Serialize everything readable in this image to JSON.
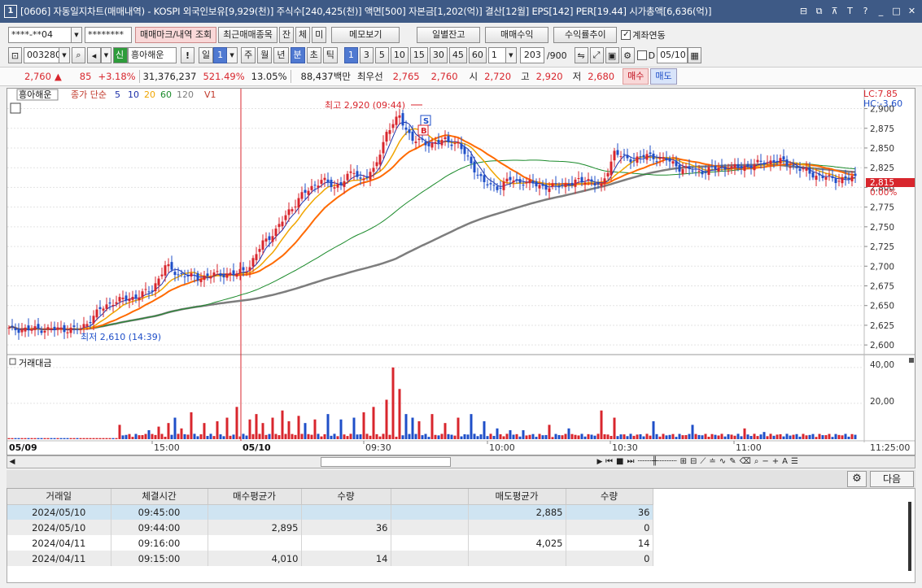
{
  "window": {
    "app_number": "1",
    "title": "[0606] 자동일지차트(매매내역) - KOSPI 외국인보유[9,929(천)] 주식수[240,425(천)] 액면[500] 자본금[1,202(억)] 결산[12월] EPS[142] PER[19.44] 시가총액[6,636(억)]",
    "buttons": [
      "⊟",
      "⧉",
      "⊼",
      "T",
      "?",
      "_",
      "□",
      "✕"
    ]
  },
  "toolbar1": {
    "account": "****-**04",
    "password": "********",
    "mark_btn": "매매마크/내역",
    "query_btn": "조회",
    "recent_btn": "최근매매종목",
    "jan": "잔",
    "che": "체",
    "mi": "미",
    "memo_btn": "메모보기",
    "daily_btn": "일별잔고",
    "profit_btn": "매매수익",
    "rate_btn": "수익률추이",
    "link_label": "계좌연동"
  },
  "toolbar2": {
    "code": "003280",
    "shin": "신",
    "stock_name": "흥아해운",
    "excl": "!",
    "periods": [
      "일",
      "1",
      "주",
      "월",
      "년",
      "분",
      "초",
      "틱"
    ],
    "intervals": [
      "1",
      "3",
      "5",
      "10",
      "15",
      "30",
      "45",
      "60"
    ],
    "count": "1",
    "bars": "203",
    "bars_max": "/900",
    "d_label": "D",
    "date": "05/10"
  },
  "quote": {
    "price": "2,760",
    "arrow": "▲",
    "change": "85",
    "rate": "+3.18%",
    "volume": "31,376,237",
    "vol_ratio": "521.49%",
    "turnover": "13.05%",
    "amount": "88,437백만",
    "pref_label": "최우선",
    "ask": "2,765",
    "bid": "2,760",
    "open_label": "시",
    "open": "2,720",
    "high_label": "고",
    "high": "2,920",
    "low_label": "저",
    "low": "2,680",
    "buy_btn": "매수",
    "sell_btn": "매도"
  },
  "chart_meta": {
    "stock_tag": "흥아해운",
    "price_series_label": "종가 단순",
    "ma_labels": [
      "5",
      "10",
      "20",
      "60",
      "120"
    ],
    "v_label": "V1",
    "volume_panel_title": "거래대금",
    "lc_label": "LC:7.85",
    "hc_label": "HC:-3.60",
    "current_price_tag": "2,815",
    "current_pct_tag": "0.00%",
    "max_annotation": "최고 2,920 (09:44)",
    "min_annotation": "최저 2,610 (14:39)",
    "buy_mark": "B",
    "sell_mark": "S",
    "vol_ticks": [
      "40,00",
      "20,00"
    ],
    "date_left": "05/09",
    "date_right": "05/10",
    "time_labels": [
      "15:00",
      "09:30",
      "10:00",
      "10:30",
      "11:00"
    ],
    "time_end": "11:25:00",
    "colors": {
      "up": "#d8262d",
      "down": "#1f4fc8",
      "ma5": "#1c2fa8",
      "ma10": "#f0a500",
      "ma20": "#ff6a00",
      "ma60": "#1a8a2a",
      "ma120": "#7d7d7d"
    }
  },
  "chart_data": {
    "type": "candlestick",
    "y_ticks": [
      2900,
      2875,
      2850,
      2825,
      2800,
      2775,
      2750,
      2725,
      2700,
      2675,
      2650,
      2625,
      2600
    ],
    "ylim": [
      2595,
      2915
    ],
    "max_point": {
      "value": 2920,
      "time": "09:44"
    },
    "min_point": {
      "value": 2610,
      "time": "14:39"
    },
    "close_path": [
      [
        0,
        2620
      ],
      [
        12,
        2620
      ],
      [
        22,
        2620
      ],
      [
        28,
        2645
      ],
      [
        32,
        2655
      ],
      [
        38,
        2660
      ],
      [
        44,
        2670
      ],
      [
        48,
        2700
      ],
      [
        52,
        2690
      ],
      [
        58,
        2685
      ],
      [
        64,
        2690
      ],
      [
        70,
        2690
      ],
      [
        74,
        2700
      ],
      [
        78,
        2730
      ],
      [
        82,
        2745
      ],
      [
        86,
        2770
      ],
      [
        90,
        2790
      ],
      [
        96,
        2810
      ],
      [
        100,
        2800
      ],
      [
        106,
        2820
      ],
      [
        108,
        2810
      ],
      [
        112,
        2820
      ],
      [
        116,
        2870
      ],
      [
        120,
        2890
      ],
      [
        124,
        2860
      ],
      [
        130,
        2855
      ],
      [
        134,
        2860
      ],
      [
        138,
        2855
      ],
      [
        142,
        2830
      ],
      [
        146,
        2805
      ],
      [
        150,
        2800
      ],
      [
        154,
        2810
      ],
      [
        160,
        2805
      ],
      [
        166,
        2800
      ],
      [
        172,
        2805
      ],
      [
        178,
        2810
      ],
      [
        182,
        2800
      ],
      [
        186,
        2845
      ],
      [
        190,
        2835
      ],
      [
        196,
        2840
      ],
      [
        202,
        2835
      ],
      [
        206,
        2825
      ],
      [
        212,
        2820
      ],
      [
        218,
        2825
      ],
      [
        224,
        2825
      ],
      [
        230,
        2830
      ],
      [
        236,
        2835
      ],
      [
        242,
        2825
      ],
      [
        248,
        2815
      ],
      [
        254,
        2810
      ],
      [
        260,
        2812
      ]
    ],
    "volume_amounts": [
      [
        34,
        8
      ],
      [
        43,
        5
      ],
      [
        46,
        7
      ],
      [
        49,
        9
      ],
      [
        51,
        12
      ],
      [
        53,
        6
      ],
      [
        56,
        15
      ],
      [
        60,
        9
      ],
      [
        64,
        10
      ],
      [
        67,
        12
      ],
      [
        70,
        18
      ],
      [
        74,
        11
      ],
      [
        76,
        14
      ],
      [
        78,
        9
      ],
      [
        81,
        12
      ],
      [
        84,
        16
      ],
      [
        86,
        10
      ],
      [
        89,
        13
      ],
      [
        91,
        9
      ],
      [
        94,
        11
      ],
      [
        98,
        14
      ],
      [
        102,
        11
      ],
      [
        106,
        12
      ],
      [
        109,
        15
      ],
      [
        112,
        18
      ],
      [
        116,
        22
      ],
      [
        118,
        40
      ],
      [
        120,
        28
      ],
      [
        122,
        14
      ],
      [
        124,
        12
      ],
      [
        126,
        10
      ],
      [
        130,
        14
      ],
      [
        134,
        9
      ],
      [
        138,
        12
      ],
      [
        142,
        14
      ],
      [
        146,
        10
      ],
      [
        150,
        6
      ],
      [
        154,
        5
      ],
      [
        158,
        5
      ],
      [
        166,
        8
      ],
      [
        172,
        6
      ],
      [
        182,
        16
      ],
      [
        186,
        12
      ],
      [
        198,
        10
      ],
      [
        210,
        8
      ],
      [
        226,
        6
      ],
      [
        232,
        4
      ]
    ],
    "volume_ticks": [
      40,
      20
    ],
    "x_labels": [
      "15:00",
      "09:30",
      "10:00",
      "10:30",
      "11:00",
      "11:25:00"
    ]
  },
  "settings": {
    "gear": "⚙",
    "next_btn": "다음"
  },
  "table": {
    "headers": [
      "거래일",
      "체결시간",
      "매수평균가",
      "수량",
      "",
      "매도평균가",
      "수량"
    ],
    "rows": [
      [
        "2024/05/10",
        "09:45:00",
        "",
        "",
        "",
        "2,885",
        "36"
      ],
      [
        "2024/05/10",
        "09:44:00",
        "2,895",
        "36",
        "",
        "",
        "0"
      ],
      [
        "2024/04/11",
        "09:16:00",
        "",
        "",
        "",
        "4,025",
        "14"
      ],
      [
        "2024/04/11",
        "09:15:00",
        "4,010",
        "14",
        "",
        "",
        "0"
      ]
    ]
  }
}
